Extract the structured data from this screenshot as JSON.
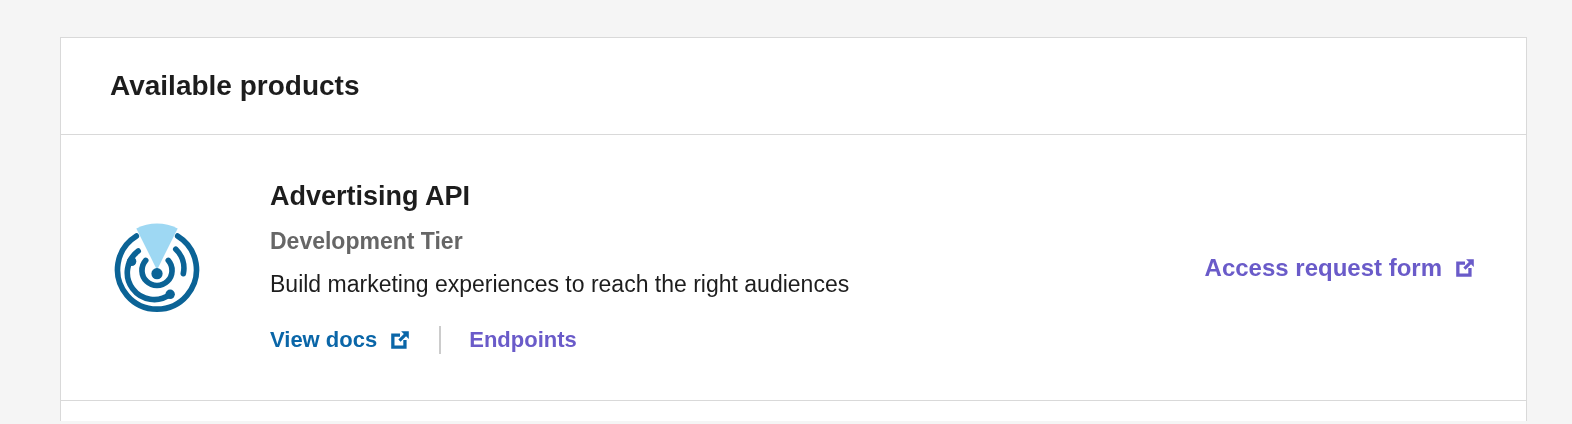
{
  "panel": {
    "title": "Available products"
  },
  "products": [
    {
      "name": "Advertising API",
      "tier": "Development Tier",
      "description": "Build marketing experiences to reach the right audiences",
      "links": [
        {
          "label": "View docs",
          "external": true,
          "kind": "docs"
        },
        {
          "label": "Endpoints",
          "external": false,
          "kind": "endpoints"
        }
      ],
      "action": {
        "label": "Access request form",
        "external": true
      }
    }
  ]
}
